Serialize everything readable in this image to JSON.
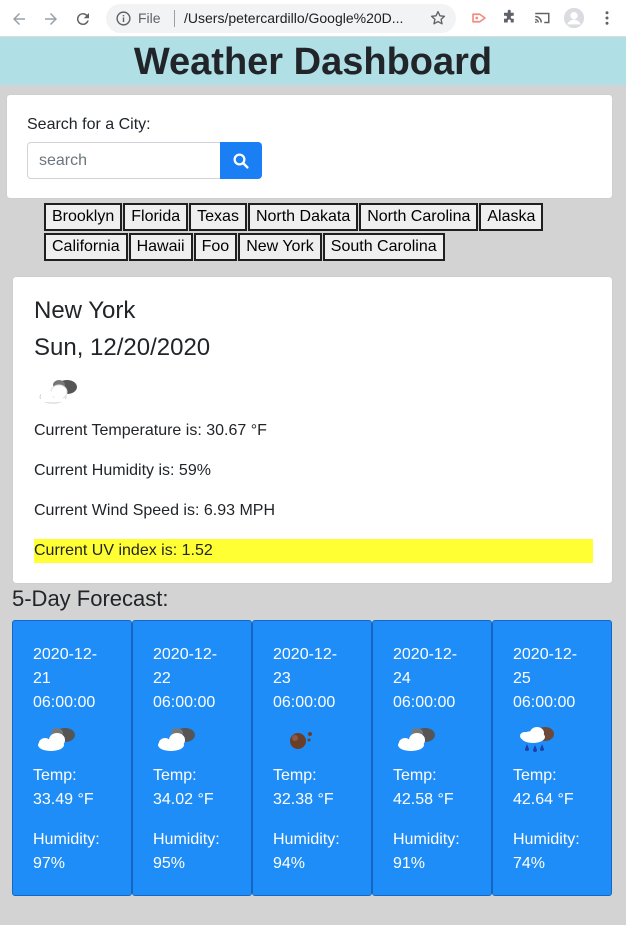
{
  "browser": {
    "file_label": "File",
    "url": "/Users/petercardillo/Google%20D..."
  },
  "header": {
    "title": "Weather Dashboard"
  },
  "search": {
    "label": "Search for a City:",
    "placeholder": "search"
  },
  "history": {
    "row1": [
      "Brooklyn",
      "Florida",
      "Texas",
      "North Dakata",
      "North Carolina",
      "Alaska"
    ],
    "row2": [
      "California",
      "Hawaii",
      "Foo",
      "New York",
      "South Carolina"
    ]
  },
  "current": {
    "city": "New York",
    "date": "Sun, 12/20/2020",
    "icon": "cloud-sun-icon",
    "temperature": "Current Temperature is: 30.67 °F",
    "humidity": "Current Humidity is: 59%",
    "wind": "Current Wind Speed is: 6.93 MPH",
    "uv": "Current UV index is: 1.52",
    "uv_color": "#ffff33"
  },
  "forecast": {
    "title": "5-Day Forecast:",
    "card_color": "#1e8df7",
    "days": [
      {
        "date_line1": "2020-12-",
        "date_line2": "21",
        "date_line3": "06:00:00",
        "icon": "cloud-sun-icon",
        "temp_label": "Temp:",
        "temp": "33.49 °F",
        "humidity_label": "Humidity:",
        "humidity": "97%"
      },
      {
        "date_line1": "2020-12-",
        "date_line2": "22",
        "date_line3": "06:00:00",
        "icon": "cloud-sun-icon",
        "temp_label": "Temp:",
        "temp": "34.02 °F",
        "humidity_label": "Humidity:",
        "humidity": "95%"
      },
      {
        "date_line1": "2020-12-",
        "date_line2": "23",
        "date_line3": "06:00:00",
        "icon": "dark-sun-icon",
        "temp_label": "Temp:",
        "temp": "32.38 °F",
        "humidity_label": "Humidity:",
        "humidity": "94%"
      },
      {
        "date_line1": "2020-12-",
        "date_line2": "24",
        "date_line3": "06:00:00",
        "icon": "cloud-sun-icon",
        "temp_label": "Temp:",
        "temp": "42.58 °F",
        "humidity_label": "Humidity:",
        "humidity": "91%"
      },
      {
        "date_line1": "2020-12-",
        "date_line2": "25",
        "date_line3": "06:00:00",
        "icon": "rain-cloud-icon",
        "temp_label": "Temp:",
        "temp": "42.64 °F",
        "humidity_label": "Humidity:",
        "humidity": "74%"
      }
    ]
  }
}
